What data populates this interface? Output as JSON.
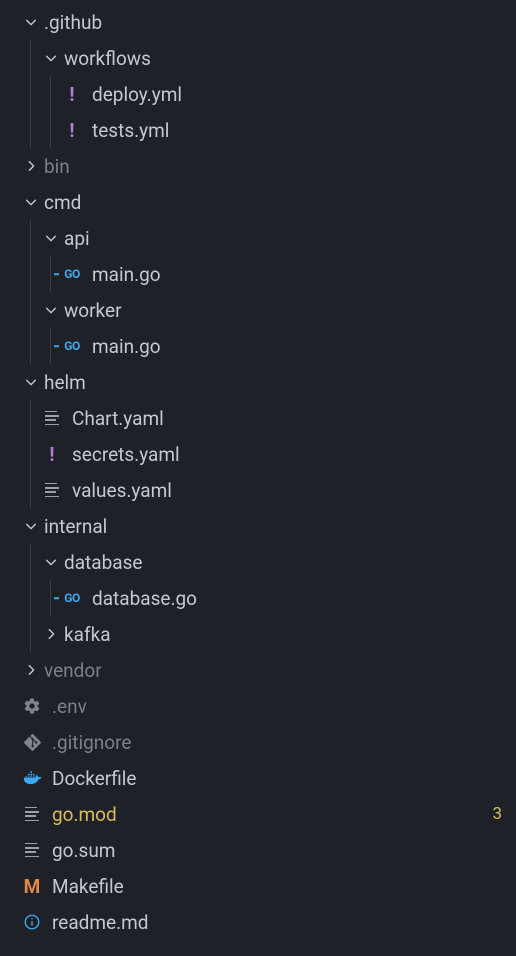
{
  "tree": {
    "github": {
      "name": ".github"
    },
    "workflows": {
      "name": "workflows"
    },
    "deploy_yml": {
      "name": "deploy.yml"
    },
    "tests_yml": {
      "name": "tests.yml"
    },
    "bin": {
      "name": "bin"
    },
    "cmd": {
      "name": "cmd"
    },
    "api": {
      "name": "api"
    },
    "api_main": {
      "name": "main.go"
    },
    "worker": {
      "name": "worker"
    },
    "worker_main": {
      "name": "main.go"
    },
    "helm": {
      "name": "helm"
    },
    "chart_yaml": {
      "name": "Chart.yaml"
    },
    "secrets_yaml": {
      "name": "secrets.yaml"
    },
    "values_yaml": {
      "name": "values.yaml"
    },
    "internal": {
      "name": "internal"
    },
    "database": {
      "name": "database"
    },
    "database_go": {
      "name": "database.go"
    },
    "kafka": {
      "name": "kafka"
    },
    "vendor": {
      "name": "vendor"
    },
    "env": {
      "name": ".env"
    },
    "gitignore": {
      "name": ".gitignore"
    },
    "dockerfile": {
      "name": "Dockerfile"
    },
    "go_mod": {
      "name": "go.mod",
      "badge": "3"
    },
    "go_sum": {
      "name": "go.sum"
    },
    "makefile": {
      "name": "Makefile"
    },
    "readme": {
      "name": "readme.md"
    }
  }
}
